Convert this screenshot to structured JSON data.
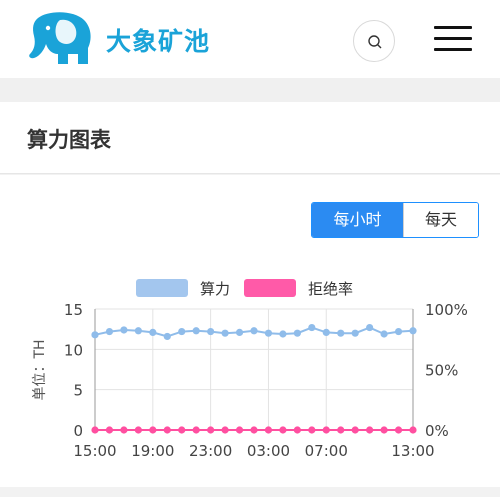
{
  "header": {
    "brand_name": "大象矿池",
    "logo_icon": "elephant-icon",
    "search_icon": "search-icon",
    "menu_icon": "hamburger-menu-icon"
  },
  "section": {
    "title": "算力图表"
  },
  "toggle": {
    "hourly_label": "每小时",
    "daily_label": "每天",
    "selected": "hourly"
  },
  "colors": {
    "brand": "#1aa3d8",
    "accent": "#2b8bf2",
    "hashrate": "#8fbcea",
    "reject": "#ff4fa0"
  },
  "chart_data": {
    "type": "line",
    "legend": [
      "算力",
      "拒绝率"
    ],
    "legend_position": "top-center",
    "ylabel_left": "单位：TH",
    "y_left_ticks": [
      "0",
      "5",
      "10",
      "15"
    ],
    "y_right_ticks": [
      "0%",
      "50%",
      "100%"
    ],
    "x_tick_labels": [
      "15:00",
      "19:00",
      "23:00",
      "03:00",
      "07:00",
      "13:00"
    ],
    "x_tick_index": [
      0,
      4,
      8,
      12,
      16,
      22
    ],
    "ylim_left": [
      0,
      15
    ],
    "ylim_right": [
      0,
      100
    ],
    "grid": true,
    "series": [
      {
        "name": "算力",
        "axis": "left",
        "values": [
          11.8,
          12.2,
          12.4,
          12.3,
          12.1,
          11.6,
          12.2,
          12.3,
          12.2,
          12.0,
          12.1,
          12.3,
          12.0,
          11.9,
          12.0,
          12.7,
          12.1,
          12.0,
          12.0,
          12.7,
          11.9,
          12.2,
          12.3
        ]
      },
      {
        "name": "拒绝率",
        "axis": "right",
        "values": [
          0,
          0,
          0,
          0,
          0,
          0,
          0,
          0,
          0,
          0,
          0,
          0,
          0,
          0,
          0,
          0,
          0,
          0,
          0,
          0,
          0,
          0,
          0
        ]
      }
    ]
  }
}
